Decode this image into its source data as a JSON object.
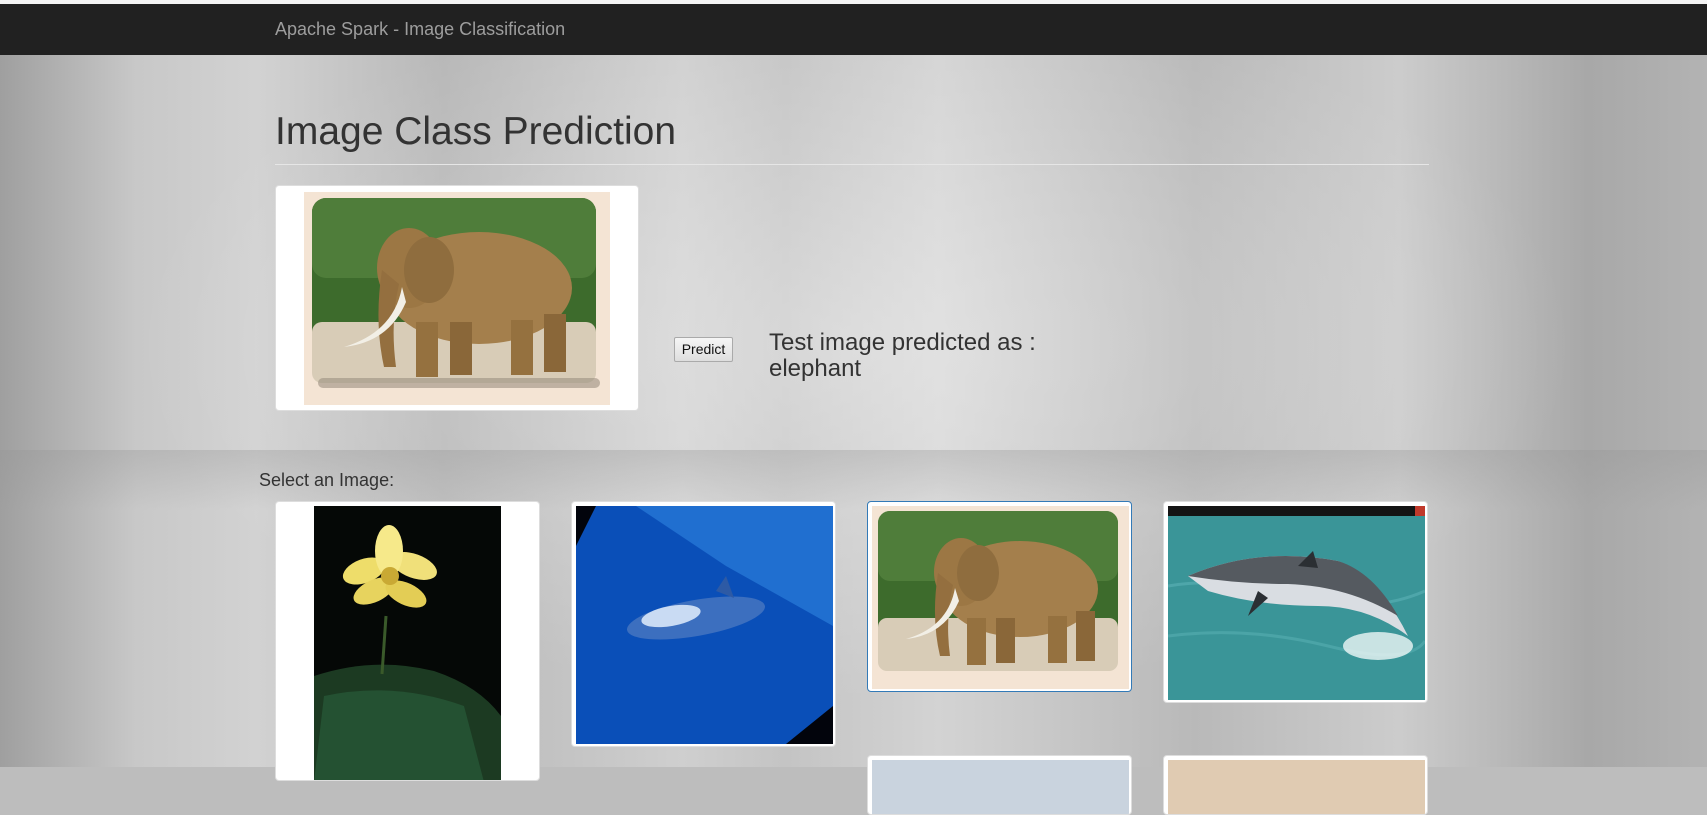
{
  "navbar": {
    "brand": "Apache Spark - Image Classification"
  },
  "main": {
    "title": "Image Class Prediction",
    "preview_image": "elephant-photo",
    "predict_label": "Predict",
    "result_prefix": "Test image predicted as :",
    "result_value": "elephant"
  },
  "gallery": {
    "label": "Select an Image:",
    "images": [
      {
        "subject": "lotus-flower-photo",
        "selected": false
      },
      {
        "subject": "dolphin-underwater-photo",
        "selected": false
      },
      {
        "subject": "elephant-photo",
        "selected": true
      },
      {
        "subject": "dolphin-jumping-photo",
        "selected": false
      },
      {
        "subject": "sky-photo",
        "selected": false
      },
      {
        "subject": "beach-photo",
        "selected": false
      }
    ]
  }
}
